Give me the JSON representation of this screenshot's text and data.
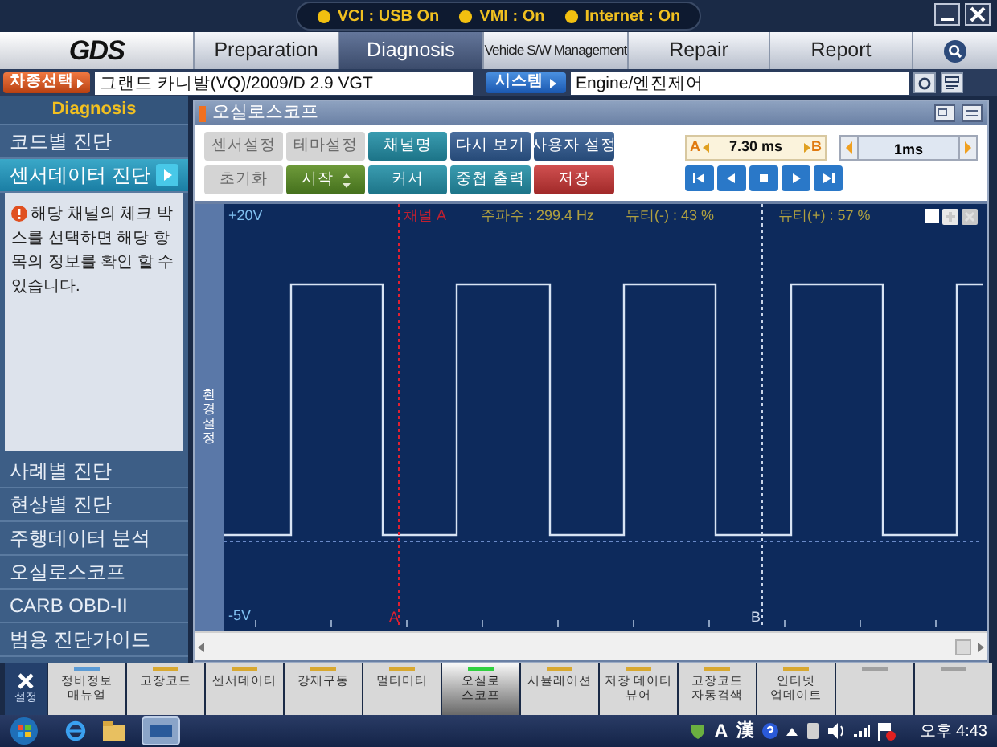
{
  "top_status": [
    {
      "label": "VCI : USB On"
    },
    {
      "label": "VMI : On"
    },
    {
      "label": "Internet : On"
    }
  ],
  "nav": {
    "logo": "GDS",
    "tabs": [
      {
        "label": "Preparation",
        "selected": false
      },
      {
        "label": "Diagnosis",
        "selected": true
      },
      {
        "label": "Vehicle S/W Management",
        "selected": false
      },
      {
        "label": "Repair",
        "selected": false
      },
      {
        "label": "Report",
        "selected": false
      }
    ]
  },
  "vehicle": {
    "select_button": "차종선택",
    "value": "그랜드 카니발(VQ)/2009/D 2.9 VGT",
    "system_button": "시스템",
    "system_value": "Engine/엔진제어"
  },
  "sidebar": {
    "title": "Diagnosis",
    "items_top": [
      {
        "label": "코드별 진단",
        "selected": false
      },
      {
        "label": "센서데이터 진단",
        "selected": true
      }
    ],
    "info": "해당 채널의 체크 박스를 선택하면 해당 항목의 정보를 확인 할 수 있습니다.",
    "items_bottom": [
      {
        "label": "사례별 진단",
        "selected": false
      },
      {
        "label": "현상별 진단",
        "selected": false
      },
      {
        "label": "주행데이터 분석",
        "selected": false
      },
      {
        "label": "오실로스코프",
        "selected": false
      },
      {
        "label": "CARB OBD-II",
        "selected": false
      },
      {
        "label": "범용 진단가이드",
        "selected": false
      }
    ]
  },
  "panel": {
    "title": "오실로스코프",
    "button_rows": [
      [
        {
          "label": "센서설정",
          "kind": "disabled",
          "stepper": false
        },
        {
          "label": "테마설정",
          "kind": "disabled",
          "stepper": false
        },
        {
          "label": "채널명",
          "kind": "teal",
          "stepper": false
        },
        {
          "label": "다시 보기",
          "kind": "blue",
          "stepper": false
        },
        {
          "label": "사용자 설정",
          "kind": "blue",
          "stepper": false
        }
      ],
      [
        {
          "label": "초기화",
          "kind": "disabled",
          "stepper": false
        },
        {
          "label": "시작",
          "kind": "green",
          "stepper": true
        },
        {
          "label": "커서",
          "kind": "teal",
          "stepper": false
        },
        {
          "label": "중첩 출력",
          "kind": "teal",
          "stepper": false
        },
        {
          "label": "저장",
          "kind": "red",
          "stepper": false
        }
      ]
    ],
    "cursor": {
      "a": "A",
      "value": "7.30 ms",
      "b": "B"
    },
    "timebase": "1ms",
    "scope": {
      "side_label": "환경설정",
      "y_max": "+20V",
      "y_min": "-5V",
      "channel": "채널 A",
      "frequency": "주파수 : 299.4 Hz",
      "duty_neg": "듀티(-) : 43 %",
      "duty_pos": "듀티(+) : 57 %",
      "cursor_a": "A",
      "cursor_b": "B",
      "checkbox_checked": false
    }
  },
  "dock": {
    "settings": "설정",
    "items": [
      {
        "label": "정비정보\n매뉴얼",
        "selected": false,
        "color": "#5b9bd5"
      },
      {
        "label": "고장코드",
        "selected": false,
        "color": "#d8a830"
      },
      {
        "label": "센서데이터",
        "selected": false,
        "color": "#d8a830"
      },
      {
        "label": "강제구동",
        "selected": false,
        "color": "#d8a830"
      },
      {
        "label": "멀티미터",
        "selected": false,
        "color": "#d8a830"
      },
      {
        "label": "오실로\n스코프",
        "selected": true,
        "color": "#30d040"
      },
      {
        "label": "시뮬레이션",
        "selected": false,
        "color": "#d8a830"
      },
      {
        "label": "저장 데이터\n뷰어",
        "selected": false,
        "color": "#d8a830"
      },
      {
        "label": "고장코드\n자동검색",
        "selected": false,
        "color": "#d8a830"
      },
      {
        "label": "인터넷\n업데이트",
        "selected": false,
        "color": "#d8a830"
      },
      {
        "selected": false,
        "color": "#a0a0a0"
      },
      {
        "selected": false,
        "color": "#a0a0a0"
      }
    ]
  },
  "taskbar": {
    "ime": "A",
    "hanja": "漢",
    "clock": "오후 4:43"
  }
}
